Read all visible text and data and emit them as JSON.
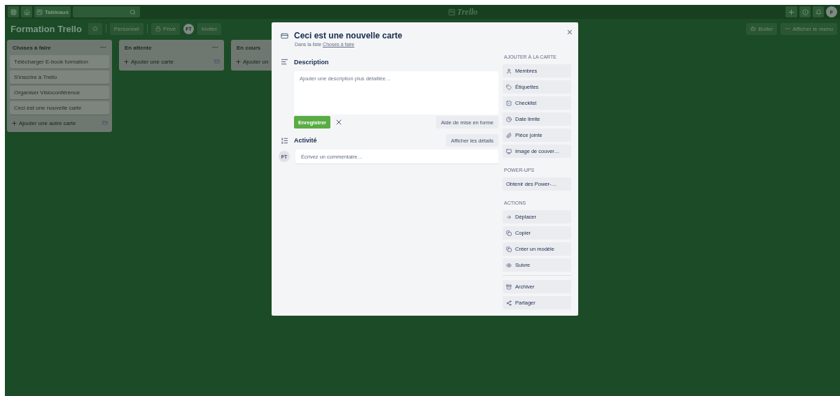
{
  "topbar": {
    "boards_label": "Tableaux",
    "logo": "Trello",
    "avatar": "F"
  },
  "board": {
    "title": "Formation Trello",
    "visibility_team": "Personnel",
    "visibility": "Privé",
    "member": "FT",
    "invite": "Inviter",
    "butler": "Butler",
    "menu": "Afficher le menu"
  },
  "lists": [
    {
      "title": "Choses à faire",
      "more": "···",
      "cards": [
        "Télécharger E-book formation",
        "S'inscrire à Trello",
        "Organiser Visioconférence",
        "Ceci est une nouvelle carte"
      ],
      "add": "Ajouter une autre carte"
    },
    {
      "title": "En attente",
      "more": "···",
      "add": "Ajouter une carte"
    },
    {
      "title": "En cours",
      "add": "Ajouter un"
    }
  ],
  "card_modal": {
    "title": "Ceci est une nouvelle carte",
    "in_list_prefix": "Dans la liste",
    "in_list": "Choses à faire",
    "close": "×",
    "description": {
      "heading": "Description",
      "placeholder": "Ajouter une description plus détaillée…",
      "save": "Enregistrer",
      "formatting_help": "Aide de mise en forme"
    },
    "activity": {
      "heading": "Activité",
      "details": "Afficher les détails",
      "avatar": "FT",
      "placeholder": "Écrivez un commentaire…"
    },
    "sidebar": [
      {
        "title": "AJOUTER À LA CARTE",
        "items": [
          "Membres",
          "Étiquettes",
          "Checklist",
          "Date limite",
          "Pièce jointe",
          "Image de couver…"
        ]
      },
      {
        "title": "POWER-UPS",
        "items": [
          "Obtenir des Power-…"
        ]
      },
      {
        "title": "ACTIONS",
        "items": [
          "Déplacer",
          "Copier",
          "Créer un modèle",
          "Suivre"
        ]
      },
      {
        "items": [
          "Archiver",
          "Partager"
        ]
      }
    ]
  }
}
